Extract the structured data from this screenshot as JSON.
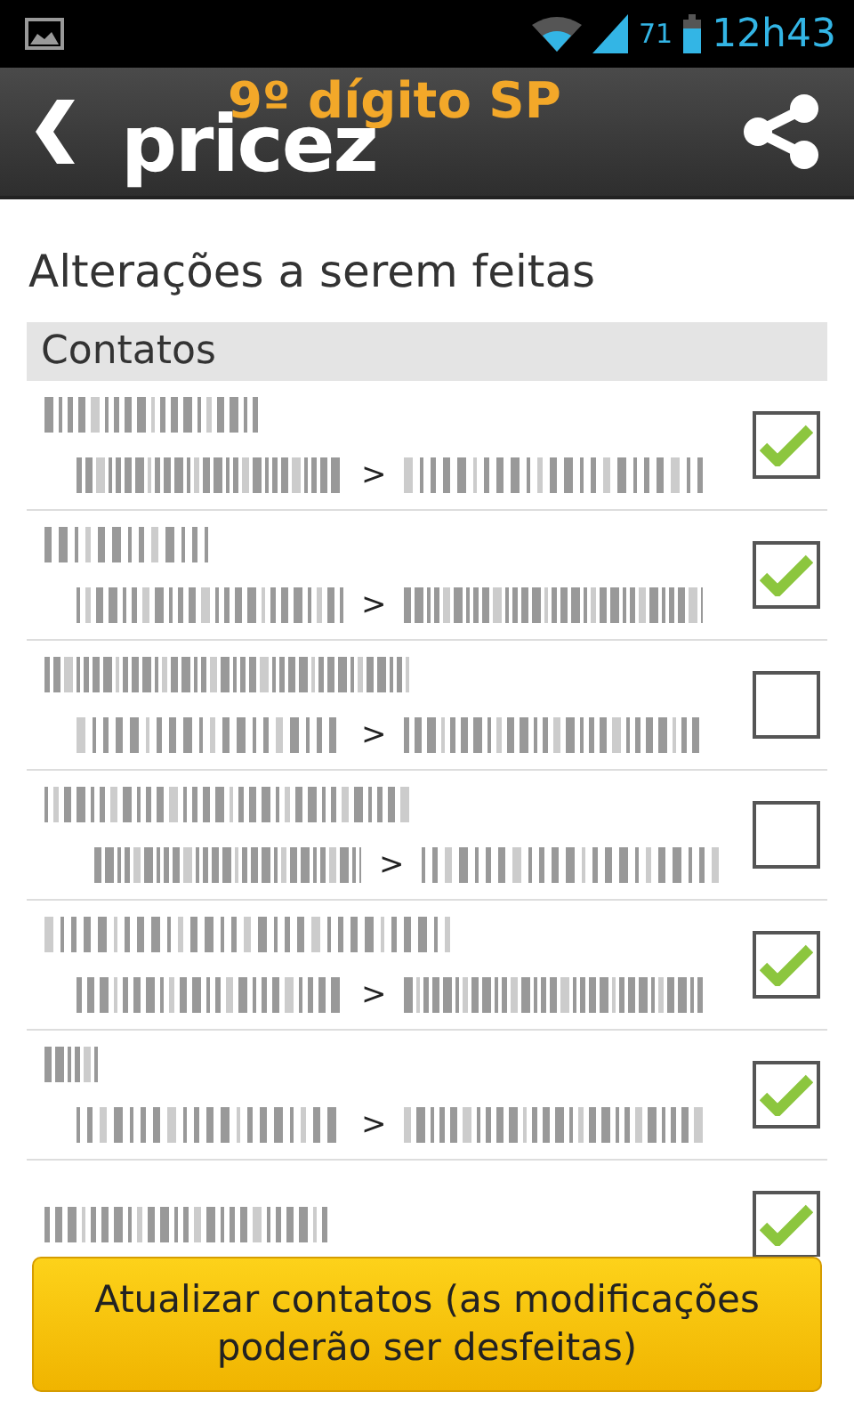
{
  "status_bar": {
    "battery": "71",
    "time": "12h43"
  },
  "app_bar": {
    "logo": "pricez",
    "subtitle": "9º dígito SP"
  },
  "title": "Alterações a serem feitas",
  "section": "Contatos",
  "contacts": [
    {
      "checked": true,
      "arrow": ">"
    },
    {
      "checked": true,
      "arrow": ">"
    },
    {
      "checked": false,
      "arrow": ">"
    },
    {
      "checked": false,
      "arrow": ">"
    },
    {
      "checked": true,
      "arrow": ">"
    },
    {
      "checked": true,
      "arrow": ">"
    },
    {
      "checked": true
    }
  ],
  "button": "Atualizar contatos (as modificações poderão ser desfeitas)"
}
